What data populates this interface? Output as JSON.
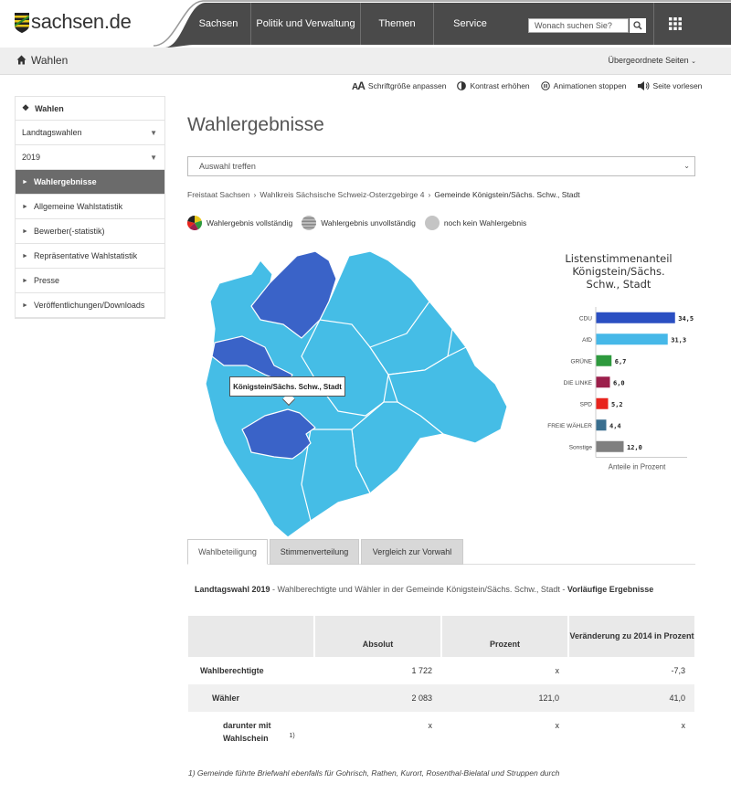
{
  "header": {
    "logo_text": "sachsen.de",
    "nav": [
      {
        "label": "Sachsen"
      },
      {
        "label": "Politik und Verwaltung"
      },
      {
        "label": "Themen"
      },
      {
        "label": "Service"
      }
    ],
    "search_placeholder": "Wonach suchen Sie?",
    "colors": {
      "nav_bg": "#4a4a4a",
      "accent_line": "#8a8a8a"
    }
  },
  "subbar": {
    "title": "Wahlen",
    "right_link": "Übergeordnete Seiten"
  },
  "tools": [
    {
      "label": "Schriftgröße anpassen",
      "icon": "font-size-icon"
    },
    {
      "label": "Kontrast erhöhen",
      "icon": "contrast-icon"
    },
    {
      "label": "Animationen stoppen",
      "icon": "pause-icon"
    },
    {
      "label": "Seite vorlesen",
      "icon": "speaker-icon"
    }
  ],
  "sidebar": {
    "head": "Wahlen",
    "dropdowns": [
      "Landtagswahlen",
      "2019"
    ],
    "items": [
      {
        "label": "Wahlergebnisse",
        "active": true
      },
      {
        "label": "Allgemeine Wahlstatistik"
      },
      {
        "label": "Bewerber(-statistik)"
      },
      {
        "label": "Repräsentative Wahlstatistik"
      },
      {
        "label": "Presse"
      },
      {
        "label": "Veröffentlichungen/Downloads"
      }
    ]
  },
  "main": {
    "title": "Wahlergebnisse",
    "select_placeholder": "Auswahl treffen",
    "breadcrumbs": [
      "Freistaat Sachsen",
      "Wahlkreis Sächsische Schweiz-Osterzgebirge 4",
      "Gemeinde Königstein/Sächs. Schw., Stadt"
    ],
    "legend": [
      {
        "label": "Wahlergebnis vollständig",
        "icon": "pie-complete-icon"
      },
      {
        "label": "Wahlergebnis unvollständig",
        "icon": "striped-circle-icon"
      },
      {
        "label": "noch kein Wahlergebnis",
        "icon": "grey-circle-icon"
      }
    ],
    "map": {
      "tooltip": "Königstein/Sächs. Schw., Stadt",
      "colors": {
        "complete": "#45bde6",
        "selected": "#3a63c8",
        "border": "#ffffff"
      }
    },
    "tabs": [
      {
        "label": "Wahlbeteiligung",
        "active": true
      },
      {
        "label": "Stimmenverteilung"
      },
      {
        "label": "Vergleich zur Vorwahl"
      }
    ],
    "table_description": {
      "lead": "Landtagswahl 2019",
      "middle": " - Wahlberechtigte und Wähler in der Gemeinde Königstein/Sächs. Schw., Stadt - ",
      "tail": "Vorläufige Ergebnisse"
    },
    "table": {
      "headers": [
        "",
        "Absolut",
        "Prozent",
        "Veränderung zu 2014 in Prozent"
      ],
      "rows": [
        {
          "label": "Wahlberechtigte",
          "absolut": "1 722",
          "prozent": "x",
          "veraenderung": "-7,3"
        },
        {
          "label": "Wähler",
          "absolut": "2 083",
          "prozent": "121,0",
          "veraenderung": "41,0"
        },
        {
          "label": "darunter mit Wahlschein",
          "sup": "1)",
          "absolut": "x",
          "prozent": "x",
          "veraenderung": "x"
        }
      ]
    },
    "footnote": "1) Gemeinde führte Briefwahl ebenfalls für Gohrisch, Rathen, Kurort, Rosenthal-Bielatal und Struppen durch"
  },
  "chart_data": {
    "type": "bar",
    "orientation": "horizontal",
    "title": "Listenstimmenanteil Königstein/Sächs. Schw., Stadt",
    "title_lines": [
      "Listenstimmenanteil",
      "Königstein/Sächs.",
      "Schw., Stadt"
    ],
    "xlabel": "Anteile in Prozent",
    "xlim": [
      0,
      40
    ],
    "categories": [
      "CDU",
      "AfD",
      "GRÜNE",
      "DIE LINKE",
      "SPD",
      "FREIE WÄHLER",
      "Sonstige"
    ],
    "values": [
      34.5,
      31.3,
      6.7,
      6.0,
      5.2,
      4.4,
      12.0
    ],
    "value_labels": [
      "34,5",
      "31,3",
      "6,7",
      "6,0",
      "5,2",
      "4,4",
      "12,0"
    ],
    "colors": [
      "#2a4fc2",
      "#46b8e8",
      "#2e9a3e",
      "#9c1f4b",
      "#e8241d",
      "#3a6f8f",
      "#7f7f7f"
    ]
  }
}
